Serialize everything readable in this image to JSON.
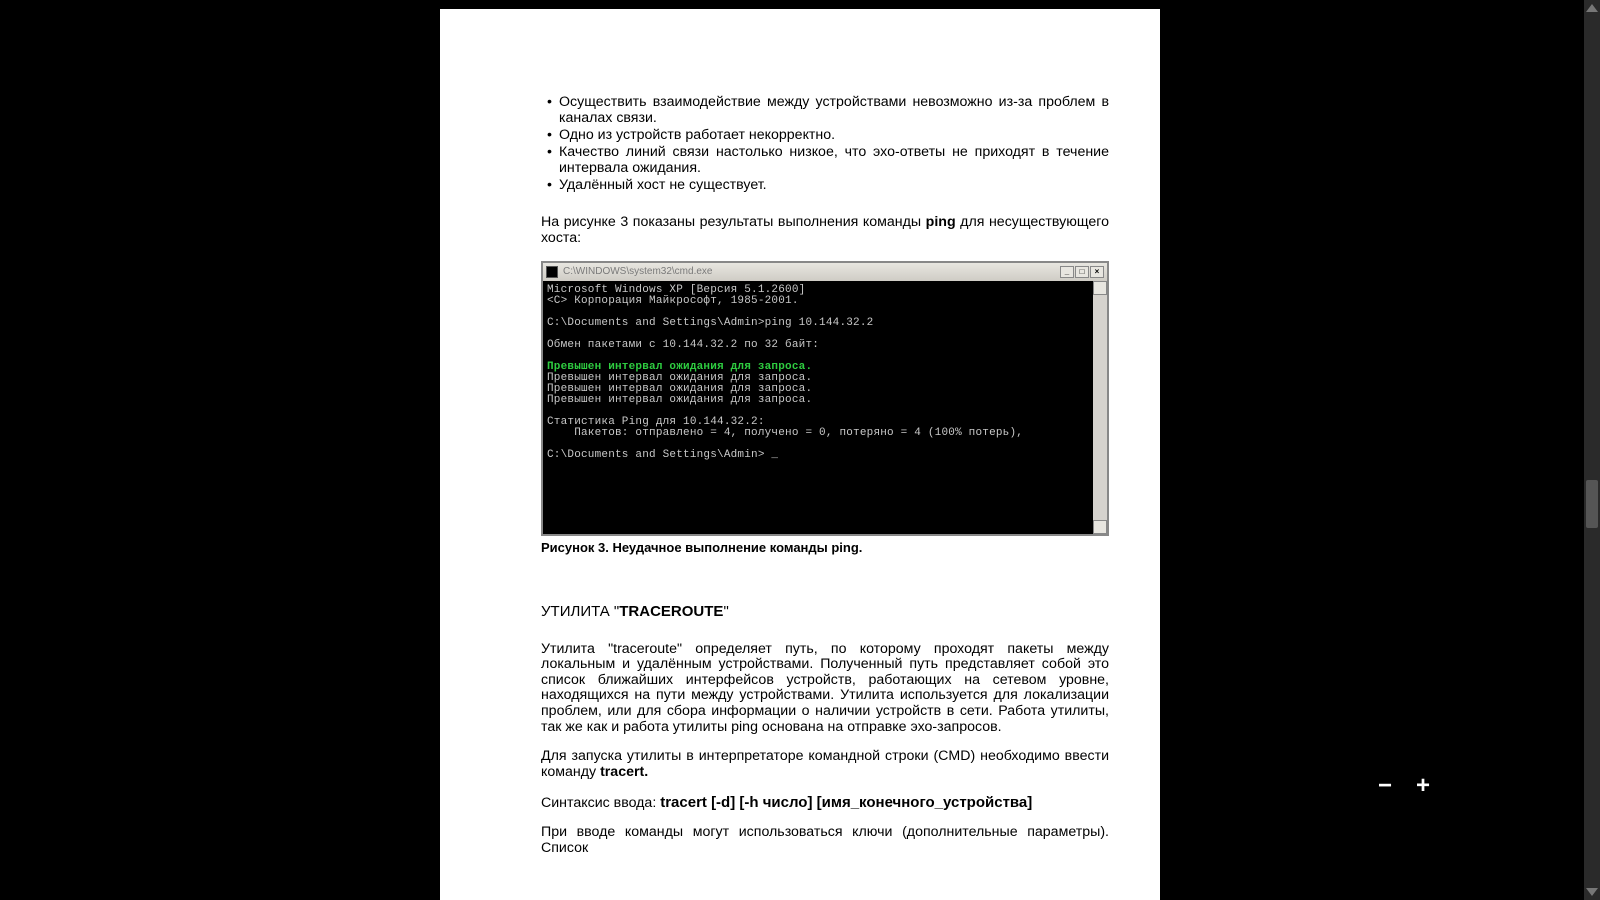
{
  "bullets": [
    "Осуществить взаимодействие между устройствами невозможно из-за проблем в каналах связи.",
    "Одно из устройств работает некорректно.",
    "Качество линий связи настолько низкое, что эхо-ответы не приходят в течение интервала ожидания.",
    "Удалённый хост не существует."
  ],
  "para1_a": "На рисунке 3 показаны результаты выполнения команды ",
  "para1_b": "ping",
  "para1_c": " для несуществующего хоста:",
  "cmd": {
    "title": "C:\\WINDOWS\\system32\\cmd.exe",
    "lines": [
      {
        "t": "Microsoft Windows XP [Версия 5.1.2600]",
        "c": "cmd-white"
      },
      {
        "t": "<C> Корпорация Майкрософт, 1985-2001.",
        "c": "cmd-white"
      },
      {
        "t": "",
        "c": "cmd-white"
      },
      {
        "t": "C:\\Documents and Settings\\Admin>ping 10.144.32.2",
        "c": "cmd-white"
      },
      {
        "t": "",
        "c": "cmd-white"
      },
      {
        "t": "Обмен пакетами с 10.144.32.2 по 32 байт:",
        "c": "cmd-white"
      },
      {
        "t": "",
        "c": "cmd-white"
      },
      {
        "t": "Превышен интервал ожидания для запроса.",
        "c": "cmd-hl"
      },
      {
        "t": "Превышен интервал ожидания для запроса.",
        "c": "cmd-white"
      },
      {
        "t": "Превышен интервал ожидания для запроса.",
        "c": "cmd-white"
      },
      {
        "t": "Превышен интервал ожидания для запроса.",
        "c": "cmd-white"
      },
      {
        "t": "",
        "c": "cmd-white"
      },
      {
        "t": "Статистика Ping для 10.144.32.2:",
        "c": "cmd-white"
      },
      {
        "t": "    Пакетов: отправлено = 4, получено = 0, потеряно = 4 (100% потерь),",
        "c": "cmd-white"
      },
      {
        "t": "",
        "c": "cmd-white"
      },
      {
        "t": "C:\\Documents and Settings\\Admin> _",
        "c": "cmd-white"
      }
    ]
  },
  "caption": "Рисунок 3. Неудачное выполнение команды ping.",
  "section": {
    "pre": "УТИЛИТА \"",
    "bold": "TRACEROUTE",
    "post": "\""
  },
  "traceroute_para": "Утилита \"traceroute\" определяет путь, по которому проходят пакеты между локальным и удалённым устройствами. Полученный путь представляет собой это список ближайших интерфейсов устройств, работающих на сетевом уровне, находящихся на пути между устройствами. Утилита используется для локализации проблем, или для сбора информации о наличии устройств в сети. Работа утилиты, так же как и работа утилиты ping основана на отправке эхо-запросов.",
  "tracert_run_a": "Для запуска утилиты в интерпретаторе командной строки (CMD) необходимо ввести команду ",
  "tracert_run_b": "tracert.",
  "syntax_label": "Синтаксис ввода: ",
  "syntax_cmd": "tracert [-d] [-h число] [имя_конечного_устройства]",
  "trail": "При вводе команды могут использоваться ключи (дополнительные параметры). Список",
  "zoom": {
    "minus": "−",
    "plus": "+"
  }
}
